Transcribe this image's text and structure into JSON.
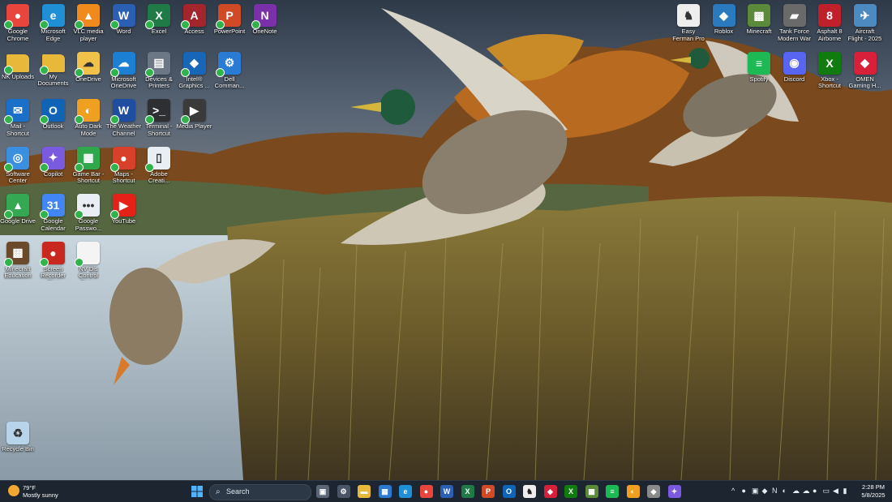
{
  "colors": {
    "taskbar": "#1c2530",
    "check_badge": "#2fb34a"
  },
  "desktop_icons": [
    {
      "label": "Google Chrome",
      "icon": "chrome-icon",
      "color": "#e8453c",
      "glyph": "●",
      "col": 0,
      "row": 0
    },
    {
      "label": "Microsoft Edge",
      "icon": "edge-icon",
      "color": "#1f8fd6",
      "glyph": "e",
      "col": 1,
      "row": 0
    },
    {
      "label": "VLC media player",
      "icon": "vlc-icon",
      "color": "#f08a1c",
      "glyph": "▲",
      "col": 2,
      "row": 0
    },
    {
      "label": "Word",
      "icon": "word-icon",
      "color": "#2b5fb4",
      "glyph": "W",
      "col": 3,
      "row": 0
    },
    {
      "label": "Excel",
      "icon": "excel-icon",
      "color": "#1f7a45",
      "glyph": "X",
      "col": 4,
      "row": 0
    },
    {
      "label": "Access",
      "icon": "access-icon",
      "color": "#a4262c",
      "glyph": "A",
      "col": 5,
      "row": 0
    },
    {
      "label": "PowerPoint",
      "icon": "powerpoint-icon",
      "color": "#d04a26",
      "glyph": "P",
      "col": 6,
      "row": 0
    },
    {
      "label": "OneNote",
      "icon": "onenote-icon",
      "color": "#7b2fa8",
      "glyph": "N",
      "col": 7,
      "row": 0
    },
    {
      "label": "NK Uploads",
      "icon": "folder-icon",
      "color": "#e8b83a",
      "glyph": "",
      "col": 0,
      "row": 1
    },
    {
      "label": "My Documents",
      "icon": "folder-icon",
      "color": "#e8b83a",
      "glyph": "",
      "col": 1,
      "row": 1
    },
    {
      "label": "OneDrive",
      "icon": "onedrive-folder-icon",
      "color": "#f0c24a",
      "glyph": "☁",
      "col": 2,
      "row": 1
    },
    {
      "label": "Microsoft OneDrive",
      "icon": "onedrive-icon",
      "color": "#1b7fd4",
      "glyph": "☁",
      "col": 3,
      "row": 1
    },
    {
      "label": "Devices & Printers",
      "icon": "printer-icon",
      "color": "#6c7785",
      "glyph": "▤",
      "col": 4,
      "row": 1
    },
    {
      "label": "Intel® Graphics ...",
      "icon": "intel-graphics-icon",
      "color": "#1766b8",
      "glyph": "◆",
      "col": 5,
      "row": 1
    },
    {
      "label": "Dell Comman...",
      "icon": "dell-command-icon",
      "color": "#2a7bd3",
      "glyph": "⚙",
      "col": 6,
      "row": 1
    },
    {
      "label": "Mail - Shortcut",
      "icon": "mail-icon",
      "color": "#1a6fc9",
      "glyph": "✉",
      "col": 0,
      "row": 2
    },
    {
      "label": "Outlook",
      "icon": "outlook-icon",
      "color": "#0f64b8",
      "glyph": "O",
      "col": 1,
      "row": 2
    },
    {
      "label": "Auto Dark Mode",
      "icon": "auto-dark-mode-icon",
      "color": "#f0a020",
      "glyph": "◐",
      "col": 2,
      "row": 2
    },
    {
      "label": "The Weather Channel",
      "icon": "weather-channel-icon",
      "color": "#1f4ea1",
      "glyph": "W",
      "col": 3,
      "row": 2
    },
    {
      "label": "Terminal - Shortcut",
      "icon": "terminal-icon",
      "color": "#2d2f33",
      "glyph": ">_",
      "col": 4,
      "row": 2
    },
    {
      "label": "Media Player",
      "icon": "media-player-icon",
      "color": "#3a3a3a",
      "glyph": "▶",
      "col": 5,
      "row": 2
    },
    {
      "label": "Software Center",
      "icon": "software-center-icon",
      "color": "#3b8fe0",
      "glyph": "◎",
      "col": 0,
      "row": 3
    },
    {
      "label": "Copilot",
      "icon": "copilot-icon",
      "color": "#7a5be0",
      "glyph": "✦",
      "col": 1,
      "row": 3
    },
    {
      "label": "Game Bar - Shortcut",
      "icon": "game-bar-icon",
      "color": "#2ea84a",
      "glyph": "▦",
      "col": 2,
      "row": 3
    },
    {
      "label": "Maps - Shortcut",
      "icon": "maps-icon",
      "color": "#d8402c",
      "glyph": "●",
      "col": 3,
      "row": 3
    },
    {
      "label": "Adobe Creati...",
      "icon": "adobe-creative-cloud-icon",
      "color": "#e8eef4",
      "glyph": "▯",
      "col": 4,
      "row": 3
    },
    {
      "label": "Google Drive",
      "icon": "google-drive-icon",
      "color": "#34a853",
      "glyph": "▲",
      "col": 0,
      "row": 4
    },
    {
      "label": "Google Calendar",
      "icon": "google-calendar-icon",
      "color": "#4285f4",
      "glyph": "31",
      "col": 1,
      "row": 4
    },
    {
      "label": "Google Passwo...",
      "icon": "google-password-icon",
      "color": "#e8eef4",
      "glyph": "•••",
      "col": 2,
      "row": 4
    },
    {
      "label": "YouTube",
      "icon": "youtube-icon",
      "color": "#e62117",
      "glyph": "▶",
      "col": 3,
      "row": 4
    },
    {
      "label": "Minecraft Education",
      "icon": "minecraft-education-icon",
      "color": "#6b4a2b",
      "glyph": "▩",
      "col": 0,
      "row": 5
    },
    {
      "label": "Screen Recorder Plus",
      "icon": "screen-recorder-icon",
      "color": "#c8281e",
      "glyph": "●",
      "col": 1,
      "row": 5
    },
    {
      "label": "NV Dis Control Pan...",
      "icon": "document-icon",
      "color": "#f4f4f4",
      "glyph": "",
      "col": 2,
      "row": 5
    },
    {
      "label": "Recycle Bin",
      "icon": "recycle-bin-icon",
      "color": "#b8d4ea",
      "glyph": "♻",
      "col": 0,
      "row": 9
    },
    {
      "label": "Easy Ferman Pro",
      "icon": "easy-app-icon",
      "color": "#eeeeee",
      "glyph": "♞",
      "col": 19,
      "row": 0
    },
    {
      "label": "Roblox",
      "icon": "roblox-icon",
      "color": "#2a7ac0",
      "glyph": "◆",
      "col": 20,
      "row": 0
    },
    {
      "label": "Minecraft",
      "icon": "minecraft-icon",
      "color": "#5a8a3a",
      "glyph": "▩",
      "col": 21,
      "row": 0
    },
    {
      "label": "Tank Force Modern War",
      "icon": "tank-force-icon",
      "color": "#6a6a6a",
      "glyph": "▰",
      "col": 22,
      "row": 0
    },
    {
      "label": "Asphalt 8 Airborne",
      "icon": "asphalt-icon",
      "color": "#c0202a",
      "glyph": "8",
      "col": 23,
      "row": 0
    },
    {
      "label": "Aircraft Flight - 2025",
      "icon": "aircraft-icon",
      "color": "#4c8ac0",
      "glyph": "✈",
      "col": 24,
      "row": 0
    },
    {
      "label": "Spotify",
      "icon": "spotify-icon",
      "color": "#1db954",
      "glyph": "≡",
      "col": 21,
      "row": 1
    },
    {
      "label": "Discord",
      "icon": "discord-icon",
      "color": "#5865f2",
      "glyph": "◉",
      "col": 22,
      "row": 1
    },
    {
      "label": "Xbox - Shortcut",
      "icon": "xbox-icon",
      "color": "#107c10",
      "glyph": "X",
      "col": 23,
      "row": 1
    },
    {
      "label": "OMEN Gaming H...",
      "icon": "omen-icon",
      "color": "#d8203a",
      "glyph": "◆",
      "col": 24,
      "row": 1
    }
  ],
  "taskbar": {
    "weather_temp": "79°F",
    "weather_condition": "Mostly sunny",
    "search_placeholder": "Search",
    "time": "2:28 PM",
    "date": "5/8/2025",
    "pinned": [
      {
        "name": "task-view",
        "color": "#5a6676",
        "glyph": "▣"
      },
      {
        "name": "settings",
        "color": "#4a5666",
        "glyph": "⚙"
      },
      {
        "name": "file-explorer",
        "color": "#e8b83a",
        "glyph": "▬"
      },
      {
        "name": "microsoft-store",
        "color": "#2a7ad3",
        "glyph": "▦"
      },
      {
        "name": "edge",
        "color": "#1f8fd6",
        "glyph": "e"
      },
      {
        "name": "chrome",
        "color": "#e8453c",
        "glyph": "●"
      },
      {
        "name": "word",
        "color": "#2b5fb4",
        "glyph": "W"
      },
      {
        "name": "excel",
        "color": "#1f7a45",
        "glyph": "X"
      },
      {
        "name": "powerpoint",
        "color": "#d04a26",
        "glyph": "P"
      },
      {
        "name": "outlook",
        "color": "#0f64b8",
        "glyph": "O"
      },
      {
        "name": "easy-app",
        "color": "#eeeeee",
        "glyph": "♞"
      },
      {
        "name": "gaming-app",
        "color": "#d8203a",
        "glyph": "◆"
      },
      {
        "name": "xbox",
        "color": "#107c10",
        "glyph": "X"
      },
      {
        "name": "minecraft",
        "color": "#5a8a3a",
        "glyph": "▩"
      },
      {
        "name": "spotify",
        "color": "#1db954",
        "glyph": "≡"
      },
      {
        "name": "auto-dark-mode",
        "color": "#f0a020",
        "glyph": "◐"
      },
      {
        "name": "roblox",
        "color": "#8a8a8a",
        "glyph": "◆"
      },
      {
        "name": "copilot",
        "color": "#7a5be0",
        "glyph": "✦"
      }
    ],
    "tray": [
      {
        "name": "chevron-up",
        "glyph": "^"
      },
      {
        "name": "tray-app-1",
        "glyph": "●"
      },
      {
        "name": "tray-app-2",
        "glyph": "▣"
      },
      {
        "name": "tray-app-3",
        "glyph": "◆"
      },
      {
        "name": "onenote-tray",
        "glyph": "N"
      },
      {
        "name": "tray-app-4",
        "glyph": "◐"
      },
      {
        "name": "onedrive-tray",
        "glyph": "☁"
      },
      {
        "name": "tray-app-5",
        "glyph": "☁"
      },
      {
        "name": "spotify-tray",
        "glyph": "●"
      },
      {
        "name": "network",
        "glyph": "▭"
      },
      {
        "name": "volume",
        "glyph": "◀"
      },
      {
        "name": "battery",
        "glyph": "▮"
      }
    ]
  }
}
